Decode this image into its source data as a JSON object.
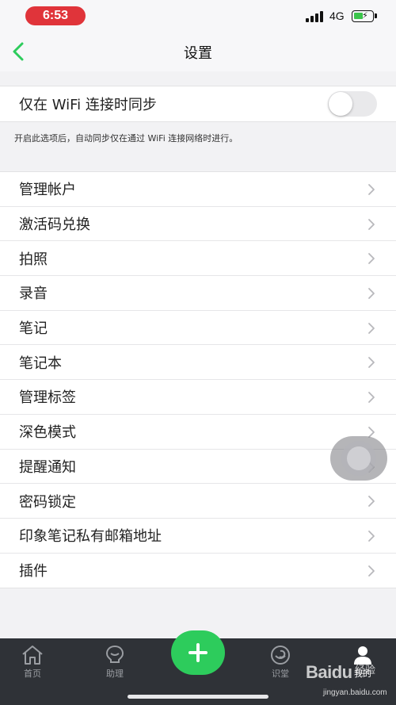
{
  "status_bar": {
    "time": "6:53",
    "network": "4G"
  },
  "nav": {
    "title": "设置"
  },
  "wifi_sync": {
    "label": "仅在 WiFi 连接时同步",
    "enabled": false,
    "hint": "开启此选项后，自动同步仅在通过 WiFi 连接网络时进行。"
  },
  "settings_items": [
    {
      "label": "管理帐户"
    },
    {
      "label": "激活码兑换"
    },
    {
      "label": "拍照"
    },
    {
      "label": "录音"
    },
    {
      "label": "笔记"
    },
    {
      "label": "笔记本"
    },
    {
      "label": "管理标签"
    },
    {
      "label": "深色模式"
    },
    {
      "label": "提醒通知"
    },
    {
      "label": "密码锁定"
    },
    {
      "label": "印象笔记私有邮箱地址"
    },
    {
      "label": "插件"
    }
  ],
  "tab_bar": {
    "tabs": [
      {
        "label": "首页",
        "icon": "home-icon"
      },
      {
        "label": "助理",
        "icon": "assistant-icon"
      },
      {
        "label": "识堂",
        "icon": "learning-icon"
      },
      {
        "label": "我的",
        "icon": "profile-icon",
        "active": true
      }
    ],
    "add_icon": "plus-icon"
  },
  "watermark": {
    "logo": "Baidu",
    "suffix": "经验",
    "url": "jingyan.baidu.com"
  },
  "colors": {
    "accent": "#2dcc5c",
    "time_pill": "#e0343a",
    "tab_bar_bg": "#2f3237"
  }
}
